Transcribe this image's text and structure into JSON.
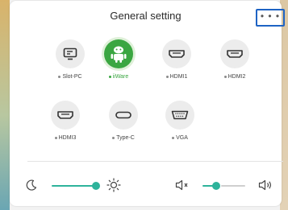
{
  "header": {
    "title": "General setting",
    "more_label": "• • •"
  },
  "sources": [
    {
      "name": "Slot-PC",
      "icon": "monitor-icon",
      "active": false
    },
    {
      "name": "iiWare",
      "icon": "android-icon",
      "active": true
    },
    {
      "name": "HDMI1",
      "icon": "hdmi-port-icon",
      "active": false
    },
    {
      "name": "HDMI2",
      "icon": "hdmi-port-icon",
      "active": false
    },
    {
      "name": "HDMI3",
      "icon": "hdmi-port-icon",
      "active": false
    },
    {
      "name": "Type-C",
      "icon": "usb-c-port-icon",
      "active": false
    },
    {
      "name": "VGA",
      "icon": "vga-port-icon",
      "active": false
    }
  ],
  "brightness": {
    "level_fraction": 1.0,
    "low_icon": "moon-icon",
    "high_icon": "sun-icon"
  },
  "volume": {
    "level_fraction": 0.35,
    "low_icon": "speaker-mute-icon",
    "high_icon": "speaker-loud-icon"
  },
  "colors": {
    "accent": "#2eb39b",
    "active_source": "#3aa641",
    "focus_outline": "#1e63c4"
  }
}
